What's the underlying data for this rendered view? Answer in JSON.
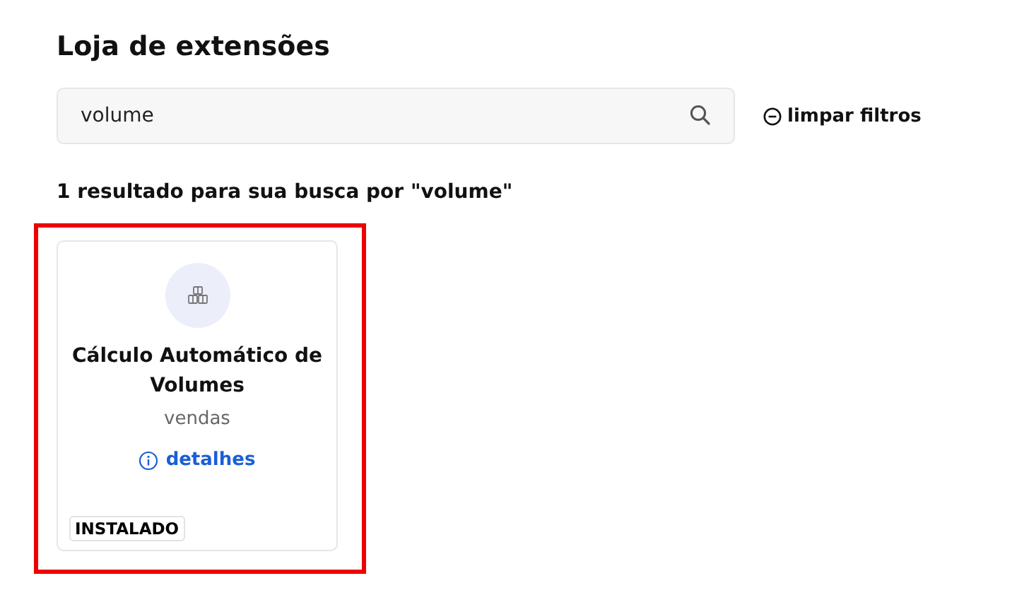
{
  "page": {
    "title": "Loja de extensões"
  },
  "search": {
    "value": "volume",
    "clear_label": "limpar filtros"
  },
  "result_summary": "1 resultado para sua busca por \"volume\"",
  "extensions": [
    {
      "name": "Cálculo Automático de Volumes",
      "category": "vendas",
      "details_label": "detalhes",
      "installed": true,
      "badge": "INSTALADO",
      "highlighted": true
    }
  ]
}
